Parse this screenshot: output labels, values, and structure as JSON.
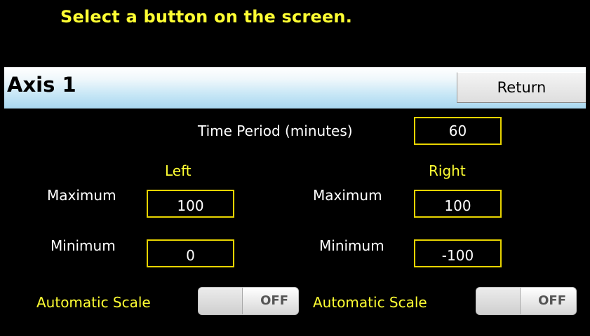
{
  "instruction": "Select a button on the screen.",
  "header": {
    "title": "Axis 1",
    "return_label": "Return"
  },
  "time_period": {
    "label": "Time Period (minutes)",
    "value": "60"
  },
  "left": {
    "heading": "Left",
    "maximum_label": "Maximum",
    "maximum_value": "100",
    "minimum_label": "Minimum",
    "minimum_value": "0",
    "auto_scale_label": "Automatic Scale",
    "auto_scale_state": "OFF"
  },
  "right": {
    "heading": "Right",
    "maximum_label": "Maximum",
    "maximum_value": "100",
    "minimum_label": "Minimum",
    "minimum_value": "-100",
    "auto_scale_label": "Automatic Scale",
    "auto_scale_state": "OFF"
  },
  "colors": {
    "accent_yellow": "#ffff33",
    "field_border": "#e8d400",
    "header_gradient_bottom": "#a9d8f0"
  }
}
